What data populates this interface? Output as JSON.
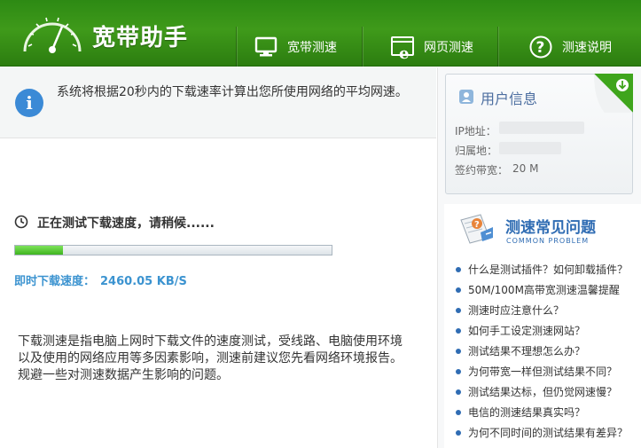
{
  "app": {
    "title": "宽带助手"
  },
  "nav": [
    {
      "label": "宽带测速",
      "icon": "monitor-icon"
    },
    {
      "label": "网页测速",
      "icon": "ie-browser-icon"
    },
    {
      "label": "测速说明",
      "icon": "help-icon"
    }
  ],
  "info": {
    "text": "系统将根据20秒内的下载速率计算出您所使用网络的平均网速。",
    "icon": "info-icon"
  },
  "test": {
    "status": "正在测试下载速度，请稍候......",
    "progress": 0.15,
    "speed_label": "即时下载速度：",
    "speed_value": "2460.05 KB/S"
  },
  "description": "下载测速是指电脑上网时下载文件的速度测试，受线路、电脑使用环境以及使用的网络应用等多因素影响，测速前建议您先看网络环境报告。规避一些对测速数据产生影响的问题。",
  "user_info": {
    "title": "用户信息",
    "ip_label": "IP地址：",
    "location_label": "归属地：",
    "bandwidth_label": "签约带宽：",
    "bandwidth_value": "20 M"
  },
  "faq": {
    "title": "测速常见问题",
    "subtitle": "COMMON PROBLEM",
    "items": [
      "什么是测试插件？如何卸载插件？",
      "50M/100M高带宽测速温馨提醒",
      "测速时应注意什么？",
      "如何手工设定测速网站？",
      "测试结果不理想怎么办？",
      "为何带宽一样但测试结果不同？",
      "测试结果达标，但仍觉网速慢？",
      "电信的测速结果真实吗？",
      "为何不同时间的测试结果有差异？"
    ]
  },
  "colors": {
    "header_green": "#3f9a1a",
    "accent_blue": "#3b93d0",
    "faq_blue": "#2f6cb3",
    "progress_green": "#4fc22c"
  }
}
